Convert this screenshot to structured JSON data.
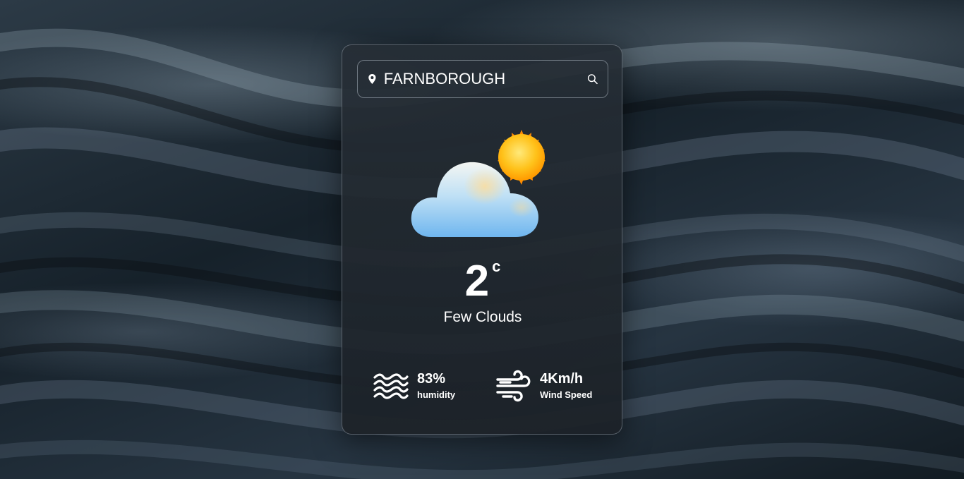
{
  "search": {
    "value": "FARNBOROUGH",
    "pin_icon": "map-pin-icon",
    "search_icon": "search-icon"
  },
  "weather": {
    "icon": "partly-cloudy-icon",
    "temperature": "2",
    "unit": "c",
    "description": "Few Clouds"
  },
  "humidity": {
    "icon": "waves-icon",
    "value": "83%",
    "label": "humidity"
  },
  "wind": {
    "icon": "wind-icon",
    "value": "4Km/h",
    "label": "Wind Speed"
  }
}
